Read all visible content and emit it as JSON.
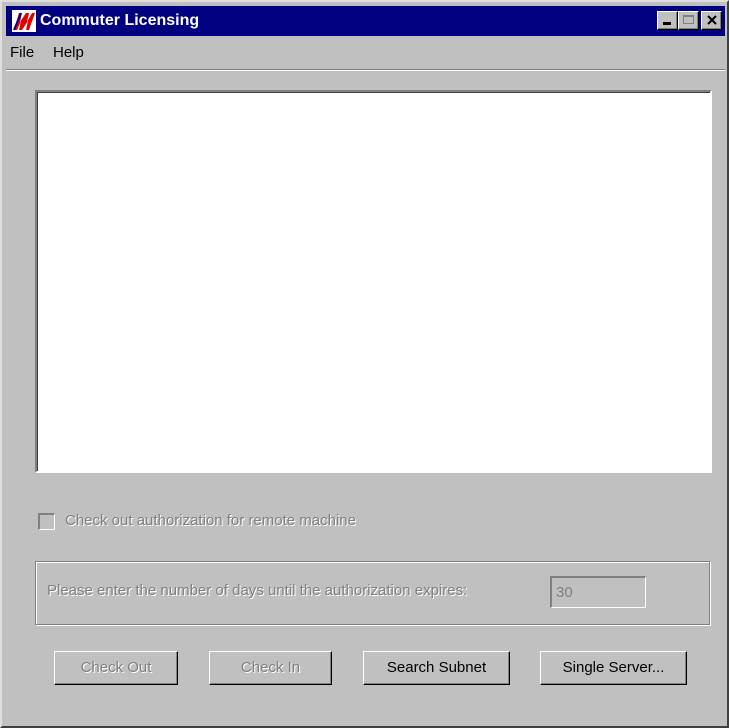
{
  "window": {
    "title": "Commuter Licensing",
    "app_icon": "lm-logo-icon",
    "controls": {
      "minimize": "minimize-icon",
      "maximize": "maximize-icon",
      "close": "close-icon"
    }
  },
  "menu": {
    "items": [
      {
        "label": "File"
      },
      {
        "label": "Help"
      }
    ]
  },
  "options": {
    "remote_checkbox_label": "Check out authorization for remote machine",
    "remote_checkbox_checked": false,
    "remote_checkbox_enabled": false
  },
  "days": {
    "label": "Please enter the number of days until the authorization expires:",
    "value": "30",
    "enabled": false
  },
  "buttons": {
    "check_out": "Check Out",
    "check_in": "Check In",
    "search_subnet": "Search Subnet",
    "single_server": "Single Server..."
  },
  "colors": {
    "titlebar": "#000080",
    "face": "#c0c0c0",
    "disabled_text": "#808080",
    "logo_red": "#e00000"
  }
}
